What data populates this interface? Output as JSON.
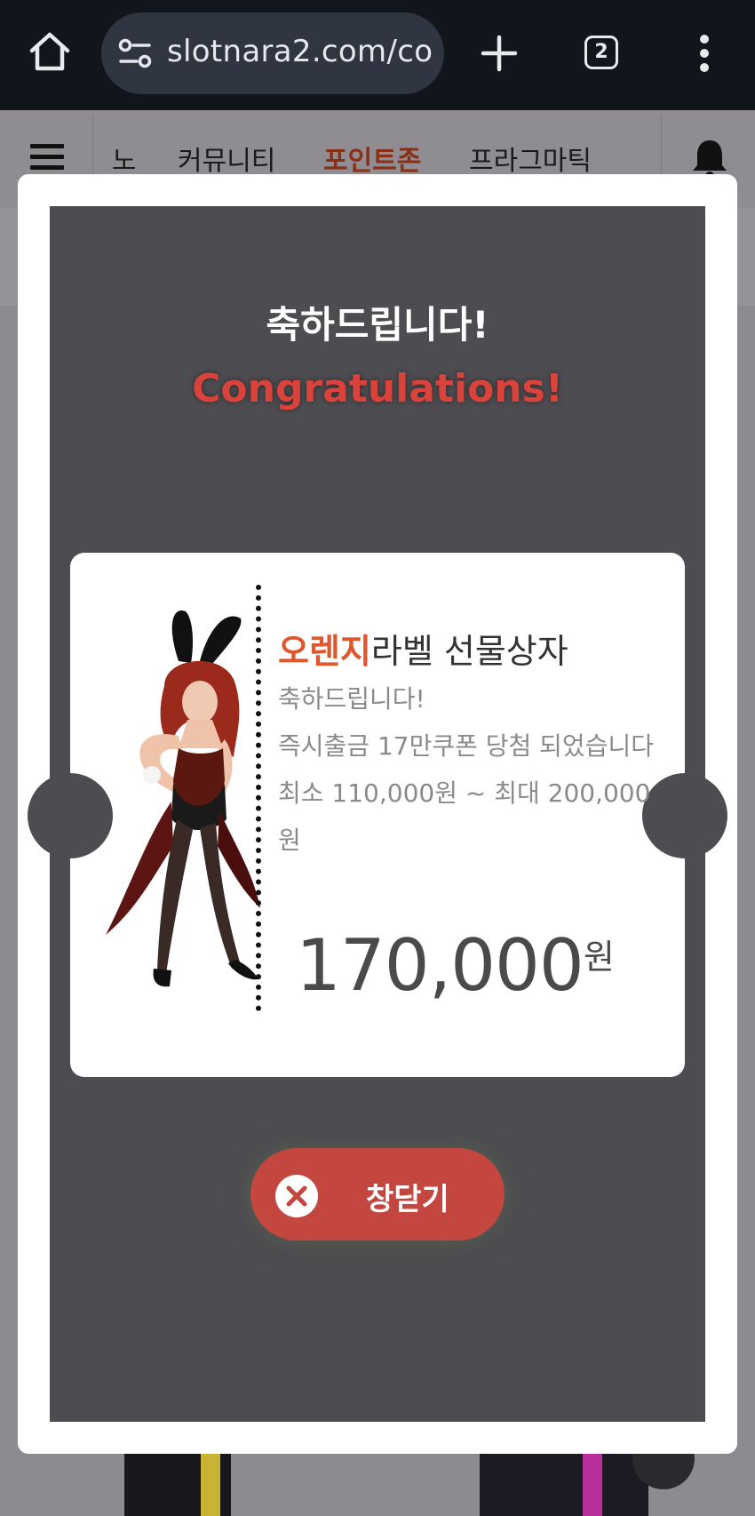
{
  "browser": {
    "url": "slotnara2.com/co",
    "tab_count": "2"
  },
  "site_nav": {
    "items": [
      {
        "label": "노"
      },
      {
        "label": "커뮤니티"
      },
      {
        "label": "포인트존"
      },
      {
        "label": "프라그마틱"
      }
    ]
  },
  "modal": {
    "heading_ko": "축하드립니다!",
    "heading_en": "Congratulations!",
    "coupon": {
      "title_accent": "오렌지",
      "title_rest": "라벨 선물상자",
      "lines": [
        "축하드립니다!",
        "즉시출금 17만쿠폰 당첨 되었습니다",
        "최소 110,000원 ~ 최대 200,000원"
      ],
      "amount": "170,000",
      "amount_unit": "원"
    },
    "close_label": "창닫기"
  },
  "colors": {
    "accent": "#e0572d",
    "congrats_red": "#d9433b",
    "close_button": "#c4473f",
    "panel": "#4d4c50"
  }
}
